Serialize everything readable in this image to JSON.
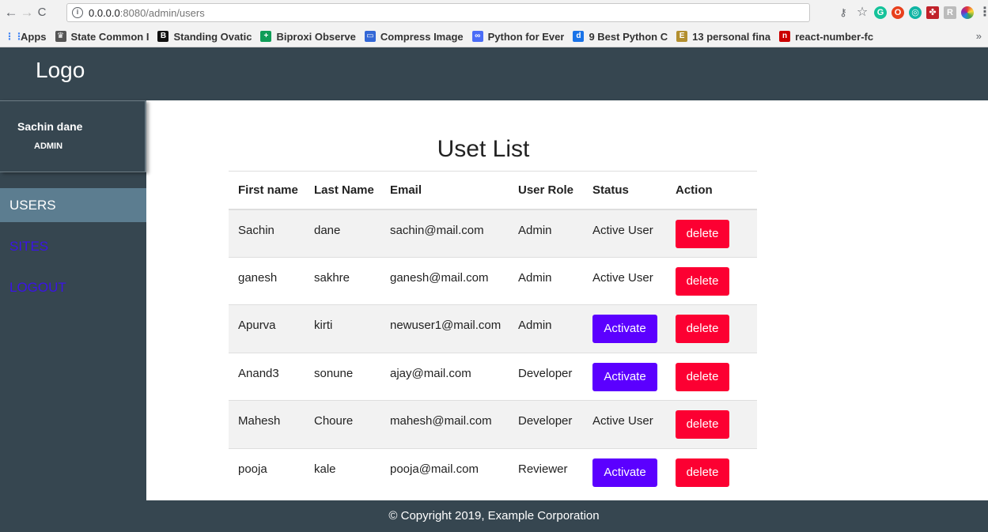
{
  "browser": {
    "url_host": "0.0.0.0",
    "url_rest": ":8080/admin/users",
    "bookmarks": [
      {
        "label": "Apps",
        "icon": "apps-grid-icon",
        "color": "#4285f4",
        "glyph": "⋮⋮"
      },
      {
        "label": "State Common I",
        "icon": "emblem-icon",
        "color": "#555555",
        "glyph": "♛"
      },
      {
        "label": "Standing Ovatic",
        "icon": "b-logo-icon",
        "color": "#111111",
        "glyph": "B"
      },
      {
        "label": "Biproxi Observe",
        "icon": "biproxi-icon",
        "color": "#0f9d58",
        "glyph": "+"
      },
      {
        "label": "Compress Image",
        "icon": "compress-image-icon",
        "color": "#3367d6",
        "glyph": "▭"
      },
      {
        "label": "Python for Ever",
        "icon": "infinity-icon",
        "color": "#4a6cf7",
        "glyph": "∞"
      },
      {
        "label": "9 Best Python C",
        "icon": "dd-icon",
        "color": "#1a73e8",
        "glyph": "d"
      },
      {
        "label": "13 personal fina",
        "icon": "et-icon",
        "color": "#b38f2f",
        "glyph": "E"
      },
      {
        "label": "react-number-fc",
        "icon": "npm-icon",
        "color": "#cb0000",
        "glyph": "n"
      }
    ]
  },
  "header": {
    "logo": "Logo"
  },
  "sidebar": {
    "user_name": "Sachin dane",
    "user_role": "ADMIN",
    "items": [
      {
        "label": "USERS",
        "active": true
      },
      {
        "label": "SITES",
        "active": false
      },
      {
        "label": "LOGOUT",
        "active": false
      }
    ]
  },
  "main": {
    "title": "Uset List",
    "columns": [
      "First name",
      "Last Name",
      "Email",
      "User Role",
      "Status",
      "Action"
    ],
    "rows": [
      {
        "first": "Sachin",
        "last": "dane",
        "email": "sachin@mail.com",
        "role": "Admin",
        "status": "Active User",
        "status_is_button": false,
        "action": "delete"
      },
      {
        "first": "ganesh",
        "last": "sakhre",
        "email": "ganesh@mail.com",
        "role": "Admin",
        "status": "Active User",
        "status_is_button": false,
        "action": "delete"
      },
      {
        "first": "Apurva",
        "last": "kirti",
        "email": "newuser1@mail.com",
        "role": "Admin",
        "status": "Activate",
        "status_is_button": true,
        "action": "delete"
      },
      {
        "first": "Anand3",
        "last": "sonune",
        "email": "ajay@mail.com",
        "role": "Developer",
        "status": "Activate",
        "status_is_button": true,
        "action": "delete"
      },
      {
        "first": "Mahesh",
        "last": "Choure",
        "email": "mahesh@mail.com",
        "role": "Developer",
        "status": "Active User",
        "status_is_button": false,
        "action": "delete"
      },
      {
        "first": "pooja",
        "last": "kale",
        "email": "pooja@mail.com",
        "role": "Reviewer",
        "status": "Activate",
        "status_is_button": true,
        "action": "delete"
      }
    ]
  },
  "footer": {
    "text": "© Copyright 2019, Example Corporation"
  },
  "colors": {
    "header_bg": "#364650",
    "sidebar_active_bg": "#5c7d90",
    "sidebar_link": "#3b13e8",
    "activate_button": "#5b00ff",
    "delete_button": "#fc0032"
  }
}
